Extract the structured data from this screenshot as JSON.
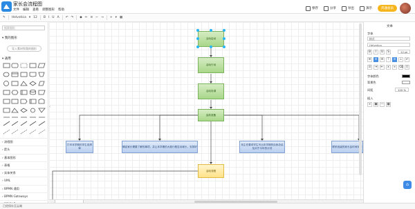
{
  "app": {
    "title": "家长会流程图",
    "menu": [
      "文件",
      "编辑",
      "查看",
      "调整图形",
      "帮助"
    ]
  },
  "header": {
    "save": "保存",
    "share": "分享",
    "export": "导出",
    "present": "演示",
    "vip": "开通会员",
    "accent": "#2b8ae1"
  },
  "toolbar": {
    "font_name": "Helvetica",
    "font_size": "12"
  },
  "left": {
    "search_placeholder": "搜索图形",
    "my_shapes": "我的图形",
    "import_label": "导入素材到我的图形",
    "general": "通用",
    "libraries": [
      "流程图",
      "箭头",
      "基本图形",
      "表格",
      "实体关系",
      "UML",
      "BPMN 通用",
      "BPMN Gateways",
      "BPMN Events"
    ]
  },
  "right": {
    "tab_text": "文本",
    "font_label": "字体",
    "font_family": "Helvetica",
    "font_size": "12 pt",
    "font_color_label": "字体颜色",
    "bg_color_label": "背景色",
    "line_height_label": "间距",
    "line_height": "120 %",
    "insert_label": "插入"
  },
  "status": {
    "text": "已经保存至云端"
  },
  "diagram": {
    "nodes": [
      {
        "id": "n1",
        "label": "活动启动",
        "style": "green"
      },
      {
        "id": "n2",
        "label": "活动行动",
        "style": "green"
      },
      {
        "id": "n3",
        "label": "活动协调",
        "style": "green"
      },
      {
        "id": "n4",
        "label": "会前准备",
        "style": "green"
      },
      {
        "id": "b1",
        "label": "打印本学期的学生成绩单",
        "style": "blue"
      },
      {
        "id": "b2",
        "label": "确定家长需要了解的事项，并让本学期的大致行程告诉家长，安排好",
        "style": "blue"
      },
      {
        "id": "b3",
        "label": "班主任要求学生写出本学期的自我总结及对于今年的计划",
        "style": "blue"
      },
      {
        "id": "b4",
        "label": "联系班级的家长会时间安排",
        "style": "blue"
      },
      {
        "id": "y1",
        "label": "活动流程",
        "style": "yellow"
      }
    ]
  }
}
